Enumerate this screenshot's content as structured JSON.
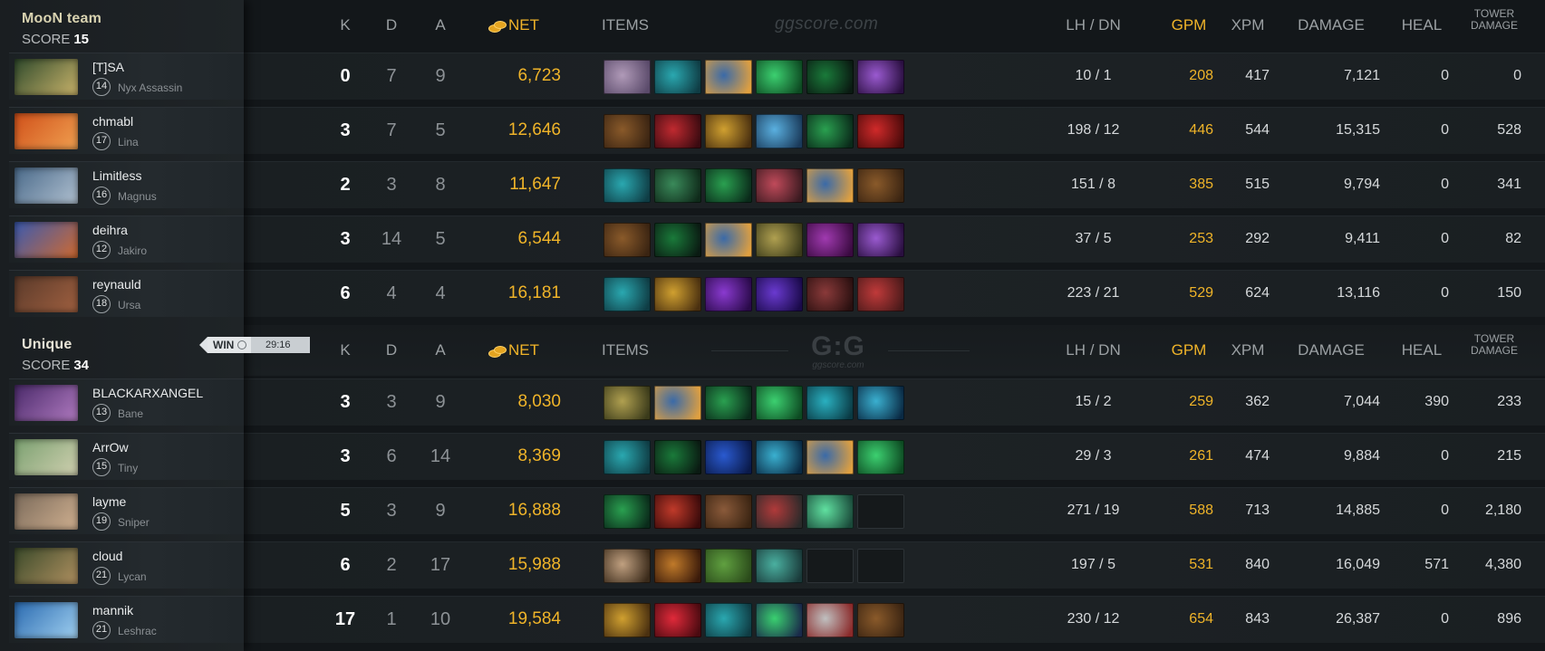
{
  "columns": {
    "k": "K",
    "d": "D",
    "a": "A",
    "net": "NET",
    "items": "ITEMS",
    "lh_dn": "LH  /  DN",
    "gpm": "GPM",
    "xpm": "XPM",
    "damage": "DAMAGE",
    "heal": "HEAL",
    "tower_line1": "TOWER",
    "tower_line2": "DAMAGE"
  },
  "watermarks": {
    "top": "ggscore.com",
    "middle_big": "G:G",
    "middle_small": "ggscore.com"
  },
  "result": {
    "label": "WIN",
    "time": "29:16"
  },
  "teams": [
    {
      "name": "MooN team",
      "score_label": "SCORE",
      "score": "15",
      "players": [
        {
          "name": "[T]SA",
          "level": "14",
          "hero": "Nyx Assassin",
          "k": "0",
          "d": "7",
          "a": "9",
          "net": "6,723",
          "lh_dn": "10  /  1",
          "gpm": "208",
          "xpm": "417",
          "damage": "7,121",
          "heal": "0",
          "tower": "0",
          "portrait": [
            "#2f4a2c",
            "#c9b36a"
          ],
          "items": [
            [
              "#b09ab8",
              "#5a4a6a"
            ],
            [
              "#2aa8b0",
              "#0f3c44"
            ],
            [
              "#3a6aa8",
              "#e0a040"
            ],
            [
              "#3cd070",
              "#0d4a22"
            ],
            [
              "#1a7a3a",
              "#0a1a12"
            ],
            [
              "#9a5ad0",
              "#2a0f40"
            ]
          ]
        },
        {
          "name": "chmabl",
          "level": "17",
          "hero": "Lina",
          "k": "3",
          "d": "7",
          "a": "5",
          "net": "12,646",
          "lh_dn": "198  /  12",
          "gpm": "446",
          "xpm": "544",
          "damage": "15,315",
          "heal": "0",
          "tower": "528",
          "portrait": [
            "#d0501a",
            "#f0a050"
          ],
          "items": [
            [
              "#8a5a2a",
              "#3a2412"
            ],
            [
              "#c02a30",
              "#3a0a10"
            ],
            [
              "#d0a030",
              "#4a3010"
            ],
            [
              "#5ab0e0",
              "#1a3a5a"
            ],
            [
              "#2aa050",
              "#0a2a1a"
            ],
            [
              "#d02a2a",
              "#4a0a0a"
            ]
          ]
        },
        {
          "name": "Limitless",
          "level": "16",
          "hero": "Magnus",
          "k": "2",
          "d": "3",
          "a": "8",
          "net": "11,647",
          "lh_dn": "151  /  8",
          "gpm": "385",
          "xpm": "515",
          "damage": "9,794",
          "heal": "0",
          "tower": "341",
          "portrait": [
            "#4a6a8a",
            "#b0c0d0"
          ],
          "items": [
            [
              "#2aa8b0",
              "#0f3c44"
            ],
            [
              "#3a8a5a",
              "#0f2a1a"
            ],
            [
              "#2aa050",
              "#0a2a1a"
            ],
            [
              "#c04a5a",
              "#3a1a20"
            ],
            [
              "#3a6aa8",
              "#e0a040"
            ],
            [
              "#8a5a2a",
              "#3a2412"
            ]
          ]
        },
        {
          "name": "deihra",
          "level": "12",
          "hero": "Jakiro",
          "k": "3",
          "d": "14",
          "a": "5",
          "net": "6,544",
          "lh_dn": "37  /  5",
          "gpm": "253",
          "xpm": "292",
          "damage": "9,411",
          "heal": "0",
          "tower": "82",
          "portrait": [
            "#3a5ab0",
            "#d06a30"
          ],
          "items": [
            [
              "#8a5a2a",
              "#3a2412"
            ],
            [
              "#1a7a3a",
              "#0a1a12"
            ],
            [
              "#3a6aa8",
              "#e0a040"
            ],
            [
              "#b0a050",
              "#3a3a1a"
            ],
            [
              "#a03ab0",
              "#3a0a40"
            ],
            [
              "#9a5ad0",
              "#2a0f40"
            ]
          ]
        },
        {
          "name": "reynauld",
          "level": "18",
          "hero": "Ursa",
          "k": "6",
          "d": "4",
          "a": "4",
          "net": "16,181",
          "lh_dn": "223  /  21",
          "gpm": "529",
          "xpm": "624",
          "damage": "13,116",
          "heal": "0",
          "tower": "150",
          "portrait": [
            "#5a3a2a",
            "#a06040"
          ],
          "items": [
            [
              "#2aa8b0",
              "#0f3c44"
            ],
            [
              "#d0a030",
              "#4a3010"
            ],
            [
              "#8a3ad0",
              "#2a0a4a"
            ],
            [
              "#6a3ad0",
              "#1a0a4a"
            ],
            [
              "#8a3a3a",
              "#2a1010"
            ],
            [
              "#c03a3a",
              "#4a1a1a"
            ]
          ]
        }
      ]
    },
    {
      "name": "Unique",
      "score_label": "SCORE",
      "score": "34",
      "players": [
        {
          "name": "BLACKARXANGEL",
          "level": "13",
          "hero": "Bane",
          "k": "3",
          "d": "3",
          "a": "9",
          "net": "8,030",
          "lh_dn": "15  /  2",
          "gpm": "259",
          "xpm": "362",
          "damage": "7,044",
          "heal": "390",
          "tower": "233",
          "portrait": [
            "#4a2a6a",
            "#b07ac0"
          ],
          "items": [
            [
              "#b0a050",
              "#3a3a1a"
            ],
            [
              "#3a6aa8",
              "#e0a040"
            ],
            [
              "#2aa050",
              "#0a2a1a"
            ],
            [
              "#3cd070",
              "#0d4a22"
            ],
            [
              "#2ab0c0",
              "#0a3a44"
            ],
            [
              "#3ab0d0",
              "#0a2a44"
            ]
          ]
        },
        {
          "name": "ArrOw",
          "level": "15",
          "hero": "Tiny",
          "k": "3",
          "d": "6",
          "a": "14",
          "net": "8,369",
          "lh_dn": "29  /  3",
          "gpm": "261",
          "xpm": "474",
          "damage": "9,884",
          "heal": "0",
          "tower": "215",
          "portrait": [
            "#7aa070",
            "#d0d0b0"
          ],
          "items": [
            [
              "#2aa8b0",
              "#0f3c44"
            ],
            [
              "#1a7a3a",
              "#0a1a12"
            ],
            [
              "#2a5ad0",
              "#0a1a4a"
            ],
            [
              "#3ab0d0",
              "#0a2a44"
            ],
            [
              "#3a6aa8",
              "#e0a040"
            ],
            [
              "#3cd070",
              "#0d4a22"
            ]
          ]
        },
        {
          "name": "layme",
          "level": "19",
          "hero": "Sniper",
          "k": "5",
          "d": "3",
          "a": "9",
          "net": "16,888",
          "lh_dn": "271  /  19",
          "gpm": "588",
          "xpm": "713",
          "damage": "14,885",
          "heal": "0",
          "tower": "2,180",
          "portrait": [
            "#7a6a5a",
            "#d0b090"
          ],
          "items": [
            [
              "#2aa050",
              "#0a2a1a"
            ],
            [
              "#c03a2a",
              "#3a0a0a"
            ],
            [
              "#8a5a3a",
              "#3a2412"
            ],
            [
              "#b03a3a",
              "#2a2a2a"
            ],
            [
              "#60e0a0",
              "#1a4a3a"
            ],
            null
          ]
        },
        {
          "name": "cloud",
          "level": "21",
          "hero": "Lycan",
          "k": "6",
          "d": "2",
          "a": "17",
          "net": "15,988",
          "lh_dn": "197  /  5",
          "gpm": "531",
          "xpm": "840",
          "damage": "16,049",
          "heal": "571",
          "tower": "4,380",
          "portrait": [
            "#3a4a2a",
            "#b09060"
          ],
          "items": [
            [
              "#c0a080",
              "#3a2a1a"
            ],
            [
              "#c07a2a",
              "#3a1a0a"
            ],
            [
              "#60a040",
              "#2a4a1a"
            ],
            [
              "#4ab0a0",
              "#1a3a3a"
            ],
            null,
            null
          ]
        },
        {
          "name": "mannik",
          "level": "21",
          "hero": "Leshrac",
          "k": "17",
          "d": "1",
          "a": "10",
          "net": "19,584",
          "lh_dn": "230  /  12",
          "gpm": "654",
          "xpm": "843",
          "damage": "26,387",
          "heal": "0",
          "tower": "896",
          "portrait": [
            "#2a6ab0",
            "#a0d0f0"
          ],
          "items": [
            [
              "#d0a030",
              "#4a3010"
            ],
            [
              "#e02a3a",
              "#4a0a10"
            ],
            [
              "#2aa8b0",
              "#0f3c44"
            ],
            [
              "#3ad070",
              "#1a2a4a"
            ],
            [
              "#c0c0c0",
              "#8a2a2a"
            ],
            [
              "#8a5a2a",
              "#3a2412"
            ]
          ]
        }
      ]
    }
  ]
}
